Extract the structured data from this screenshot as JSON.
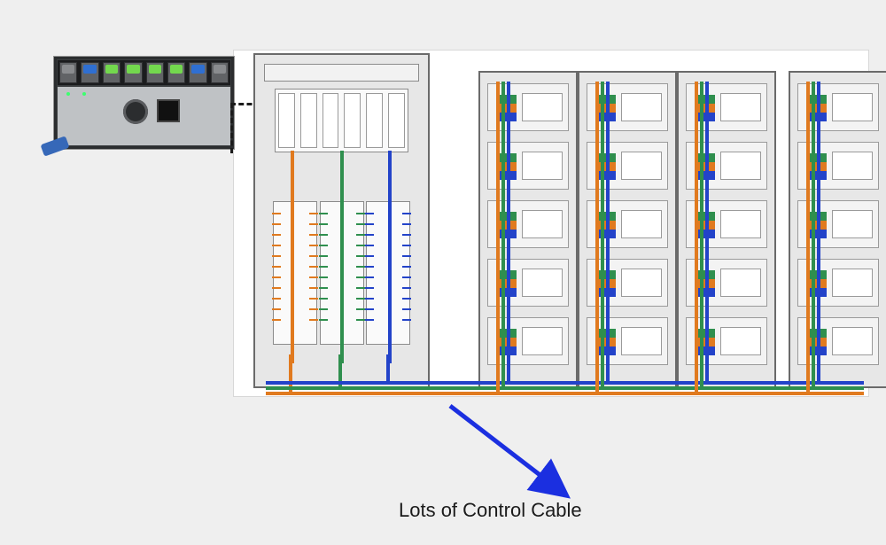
{
  "caption": "Lots of Control Cable",
  "devices": {
    "plc_name": "plc-controller-rack",
    "main_cabinet_name": "io-marshalling-cabinet",
    "mcc_column_name": "mcc-column"
  },
  "colors": {
    "orange": "#e07a1f",
    "green": "#2f8f4e",
    "blue": "#2343c9",
    "arrow": "#1b2fe0"
  },
  "mcc_units_per_column": 5,
  "mcc_columns": 4,
  "main_terminal_bays": 3,
  "main_io_cards": 6
}
